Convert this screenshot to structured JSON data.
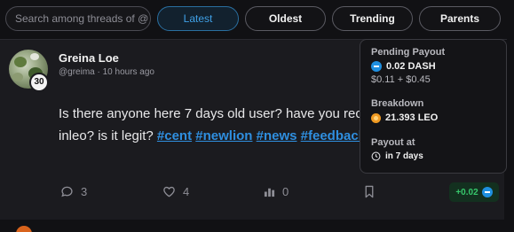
{
  "filters": {
    "search_placeholder": "Search among threads of @",
    "tabs": [
      {
        "label": "Latest",
        "active": true
      },
      {
        "label": "Oldest",
        "active": false
      },
      {
        "label": "Trending",
        "active": false
      },
      {
        "label": "Parents",
        "active": false
      }
    ]
  },
  "post": {
    "author": "Greina Loe",
    "handle": "@greima",
    "time": "10 hours ago",
    "reputation": "30",
    "text_line1": "Is there anyone here 7 days old user? have you rec",
    "text_line2_prefix": "inleo? is it legit? ",
    "tags": [
      "#cent",
      "#newlion",
      "#news",
      "#feedback"
    ],
    "replies": "3",
    "likes": "4",
    "views": "0",
    "payout_chip": "+0.02"
  },
  "popover": {
    "pending_title": "Pending Payout",
    "pending_amount": "0.02 DASH",
    "pending_split": "$0.11 + $0.45",
    "breakdown_title": "Breakdown",
    "breakdown_amount": "21.393 LEO",
    "payout_at_title": "Payout at",
    "payout_at_value": "in 7 days"
  },
  "colors": {
    "accent_blue": "#2f8fe0",
    "payout_green": "#37c86c",
    "leo_orange": "#f09a22"
  }
}
